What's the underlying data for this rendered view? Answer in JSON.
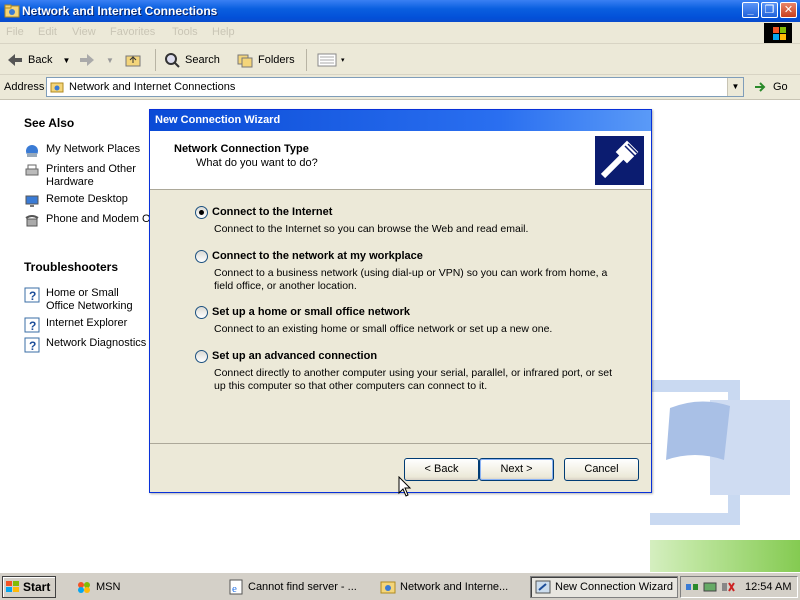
{
  "window": {
    "title": "Network and Internet Connections",
    "controls": [
      "_",
      "❐",
      "✕"
    ]
  },
  "menu": [
    "File",
    "Edit",
    "View",
    "Favorites",
    "Tools",
    "Help"
  ],
  "toolbar": {
    "back": "Back",
    "search": "Search",
    "folders": "Folders"
  },
  "address": {
    "label": "Address",
    "value": "Network and Internet Connections",
    "go": "Go"
  },
  "leftpane": {
    "see_also": {
      "heading": "See Also",
      "items": [
        "My Network Places",
        "Printers and Other Hardware",
        "Remote Desktop",
        "Phone and Modem Op"
      ]
    },
    "troubleshooters": {
      "heading": "Troubleshooters",
      "items": [
        "Home or Small Office Networking",
        "Internet Explorer",
        "Network Diagnostics"
      ]
    }
  },
  "wizard": {
    "title": "New Connection Wizard",
    "header_title": "Network Connection Type",
    "header_subtitle": "What do you want to do?",
    "options": [
      {
        "label": "Connect to the Internet",
        "desc": "Connect to the Internet so you can browse the Web and read email.",
        "selected": true
      },
      {
        "label": "Connect to the network at my workplace",
        "desc": "Connect to a business network (using dial-up or VPN) so you can work from home, a field office, or another location.",
        "selected": false
      },
      {
        "label": "Set up a home or small office network",
        "desc": "Connect to an existing home or small office network or set up a new one.",
        "selected": false
      },
      {
        "label": "Set up an advanced connection",
        "desc": "Connect directly to another computer using your serial, parallel, or infrared port, or set up this computer so that other computers can connect to it.",
        "selected": false
      }
    ],
    "buttons": {
      "back": "< Back",
      "next": "Next >",
      "cancel": "Cancel"
    }
  },
  "taskbar": {
    "start": "Start",
    "tasks": [
      "MSN",
      "Cannot find server - ...",
      "Network and Interne...",
      "New Connection Wizard"
    ],
    "clock": "12:54 AM"
  },
  "colors": {
    "titlebar": "#0a5fe0",
    "wizard_title": "#0a4bd6",
    "dialog_bg": "#ece9d8"
  }
}
